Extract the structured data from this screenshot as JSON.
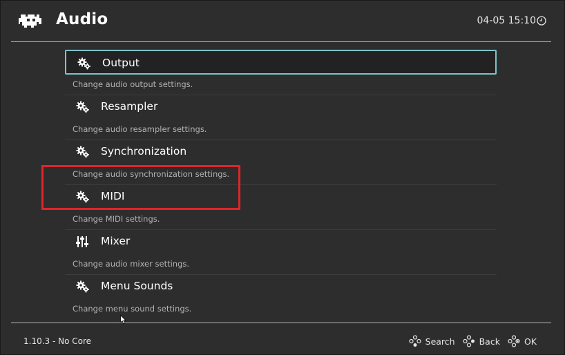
{
  "header": {
    "title": "Audio",
    "clock": "04-05 15:10",
    "logo_icon": "retroarch-invader-icon",
    "clock_icon": "clock-icon"
  },
  "menu": {
    "items": [
      {
        "label": "Output",
        "description": "Change audio output settings.",
        "icon": "gears-icon",
        "selected": true
      },
      {
        "label": "Resampler",
        "description": "Change audio resampler settings.",
        "icon": "gears-icon",
        "selected": false
      },
      {
        "label": "Synchronization",
        "description": "Change audio synchronization settings.",
        "icon": "gears-icon",
        "selected": false
      },
      {
        "label": "MIDI",
        "description": "Change MIDI settings.",
        "icon": "gears-icon",
        "selected": false
      },
      {
        "label": "Mixer",
        "description": "Change audio mixer settings.",
        "icon": "sliders-icon",
        "selected": false
      },
      {
        "label": "Menu Sounds",
        "description": "Change menu sound settings.",
        "icon": "gears-icon",
        "selected": false
      }
    ]
  },
  "footer": {
    "version": "1.10.3 - No Core",
    "actions": [
      {
        "label": "Search",
        "icon": "gamepad-buttons-icon"
      },
      {
        "label": "Back",
        "icon": "gamepad-buttons-icon"
      },
      {
        "label": "OK",
        "icon": "gamepad-buttons-icon"
      }
    ]
  },
  "colors": {
    "background": "#2d2d2d",
    "selection_border": "#7fc3c9",
    "annotation_red": "#e0242a",
    "text": "#ffffff",
    "subtext": "#b3b3b3"
  }
}
